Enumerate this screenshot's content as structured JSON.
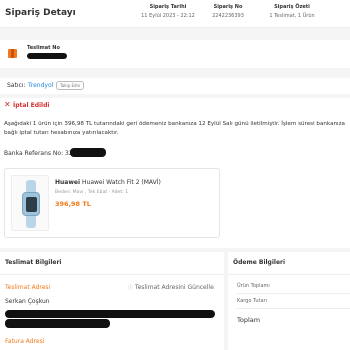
{
  "header": {
    "title": "Sipariş Detayı",
    "order_date_label": "Sipariş Tarihi",
    "order_date_value": "11 Eylül 2023 - 22:12",
    "order_no_label": "Sipariş No",
    "order_no_value": "2242236393",
    "summary_label": "Sipariş Özeti",
    "summary_value": "1 Teslimat, 1 Ürün"
  },
  "delivery": {
    "label": "Teslimat No",
    "icon": "package-icon"
  },
  "seller": {
    "label": "Satıcı:",
    "name": "Trendyol",
    "follow_button": "Takip Edin"
  },
  "cancel": {
    "status": "İptal Edildi",
    "icon": "x-icon",
    "notice": "Aşağıdaki 1 ürün için 396,98 TL tutarındaki geri ödemeniz bankanıza 12 Eylül Salı günü iletilmiştir. İşlem süresi bankanıza bağlı iptal tutarı hesabınıza yatırılacaktır.",
    "bank_ref_label": "Banka Referans No: 325"
  },
  "product": {
    "brand": "Huawei",
    "name": "Huawei Watch Fit 2 (MAVİ)",
    "attributes": "Beden: Mavi , Tek Ebat · Adet: 1",
    "price": "396,98 TL",
    "image_icon": "smartwatch-image"
  },
  "delivery_info": {
    "title": "Teslimat Bilgileri",
    "address_label": "Teslimat Adresi",
    "address_change": "Teslimat Adresini Güncelle",
    "recipient": "Serkan Çoşkun",
    "billing_label": "Fatura Adresi"
  },
  "payment_info": {
    "title": "Ödeme Bilgileri",
    "product_total_label": "Ürün Toplamı",
    "shipping_label": "Kargo Tutarı",
    "total_label": "Toplam"
  },
  "colors": {
    "brand_orange": "#f27a1a",
    "cancel_red": "#d32f2f",
    "link_blue": "#1e88e5"
  }
}
